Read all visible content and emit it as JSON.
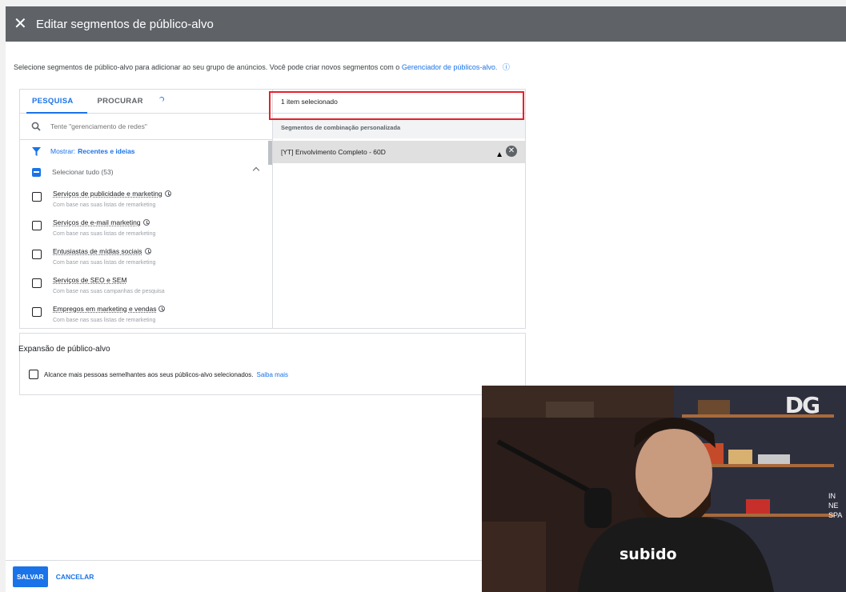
{
  "header": {
    "close_icon": "close-icon",
    "title": "Editar segmentos de público-alvo"
  },
  "intro": {
    "text": "Selecione segmentos de público-alvo para adicionar ao seu grupo de anúncios. Você pode criar novos segmentos com o ",
    "link": "Gerenciador de públicos-alvo.",
    "help_icon": "help-icon"
  },
  "tabs": [
    {
      "label": "PESQUISA"
    },
    {
      "label": "PROCURAR"
    }
  ],
  "search": {
    "placeholder": "Tente \"gerenciamento de redes\""
  },
  "filter": {
    "label": "Mostrar:",
    "value": "Recentes e ideias"
  },
  "select_all": {
    "label": "Selecionar tudo (53)"
  },
  "items": [
    {
      "name": "Serviços de publicidade e marketing",
      "sub": "Com base nas suas listas de remarketing"
    },
    {
      "name": "Serviços de e-mail marketing",
      "sub": "Com base nas suas listas de remarketing"
    },
    {
      "name": "Entusiastas de mídias sociais",
      "sub": "Com base nas suas listas de remarketing"
    },
    {
      "name": "Serviços de SEO e SEM",
      "sub": "Com base nas suas campanhas de pesquisa"
    },
    {
      "name": "Empregos em marketing e vendas",
      "sub": "Com base nas suas listas de remarketing"
    }
  ],
  "selected": {
    "count": "1 item selecionado",
    "group": "Segmentos de combinação personalizada",
    "item": "[YT] Envolvimento Completo - 60D"
  },
  "expansion": {
    "title": "Expansão de público-alvo",
    "label": "Alcance mais pessoas semelhantes aos seus públicos-alvo selecionados.",
    "link": "Saiba mais"
  },
  "footer": {
    "save": "SALVAR",
    "cancel": "CANCELAR"
  },
  "webcam": {
    "logo": "DG",
    "shirt": "subido",
    "sign": "IN\nNE\nSPA"
  },
  "colors": {
    "accent": "#1a73e8",
    "header": "#5f6368",
    "highlight": "#e8202a"
  }
}
